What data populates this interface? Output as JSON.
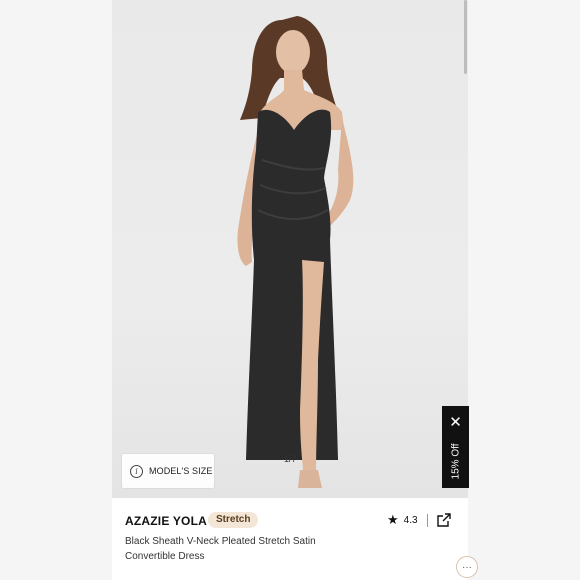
{
  "gallery": {
    "counter": "1/7",
    "model_size_label": "MODEL'S SIZE",
    "info_icon_glyph": "i"
  },
  "promo": {
    "close_glyph": "✕",
    "label": "15% Off"
  },
  "product": {
    "brand": "AZAZIE YOLA",
    "badge": "Stretch",
    "rating": "4.3",
    "star_glyph": "★",
    "title": "Black Sheath V-Neck Pleated Stretch Satin Convertible Dress"
  },
  "chat": {
    "glyph": "···"
  },
  "colors": {
    "background": "#f3f3f3",
    "promo_bg": "#111111",
    "badge_bg": "#f3e6d6",
    "dress": "#2b2b2b"
  }
}
